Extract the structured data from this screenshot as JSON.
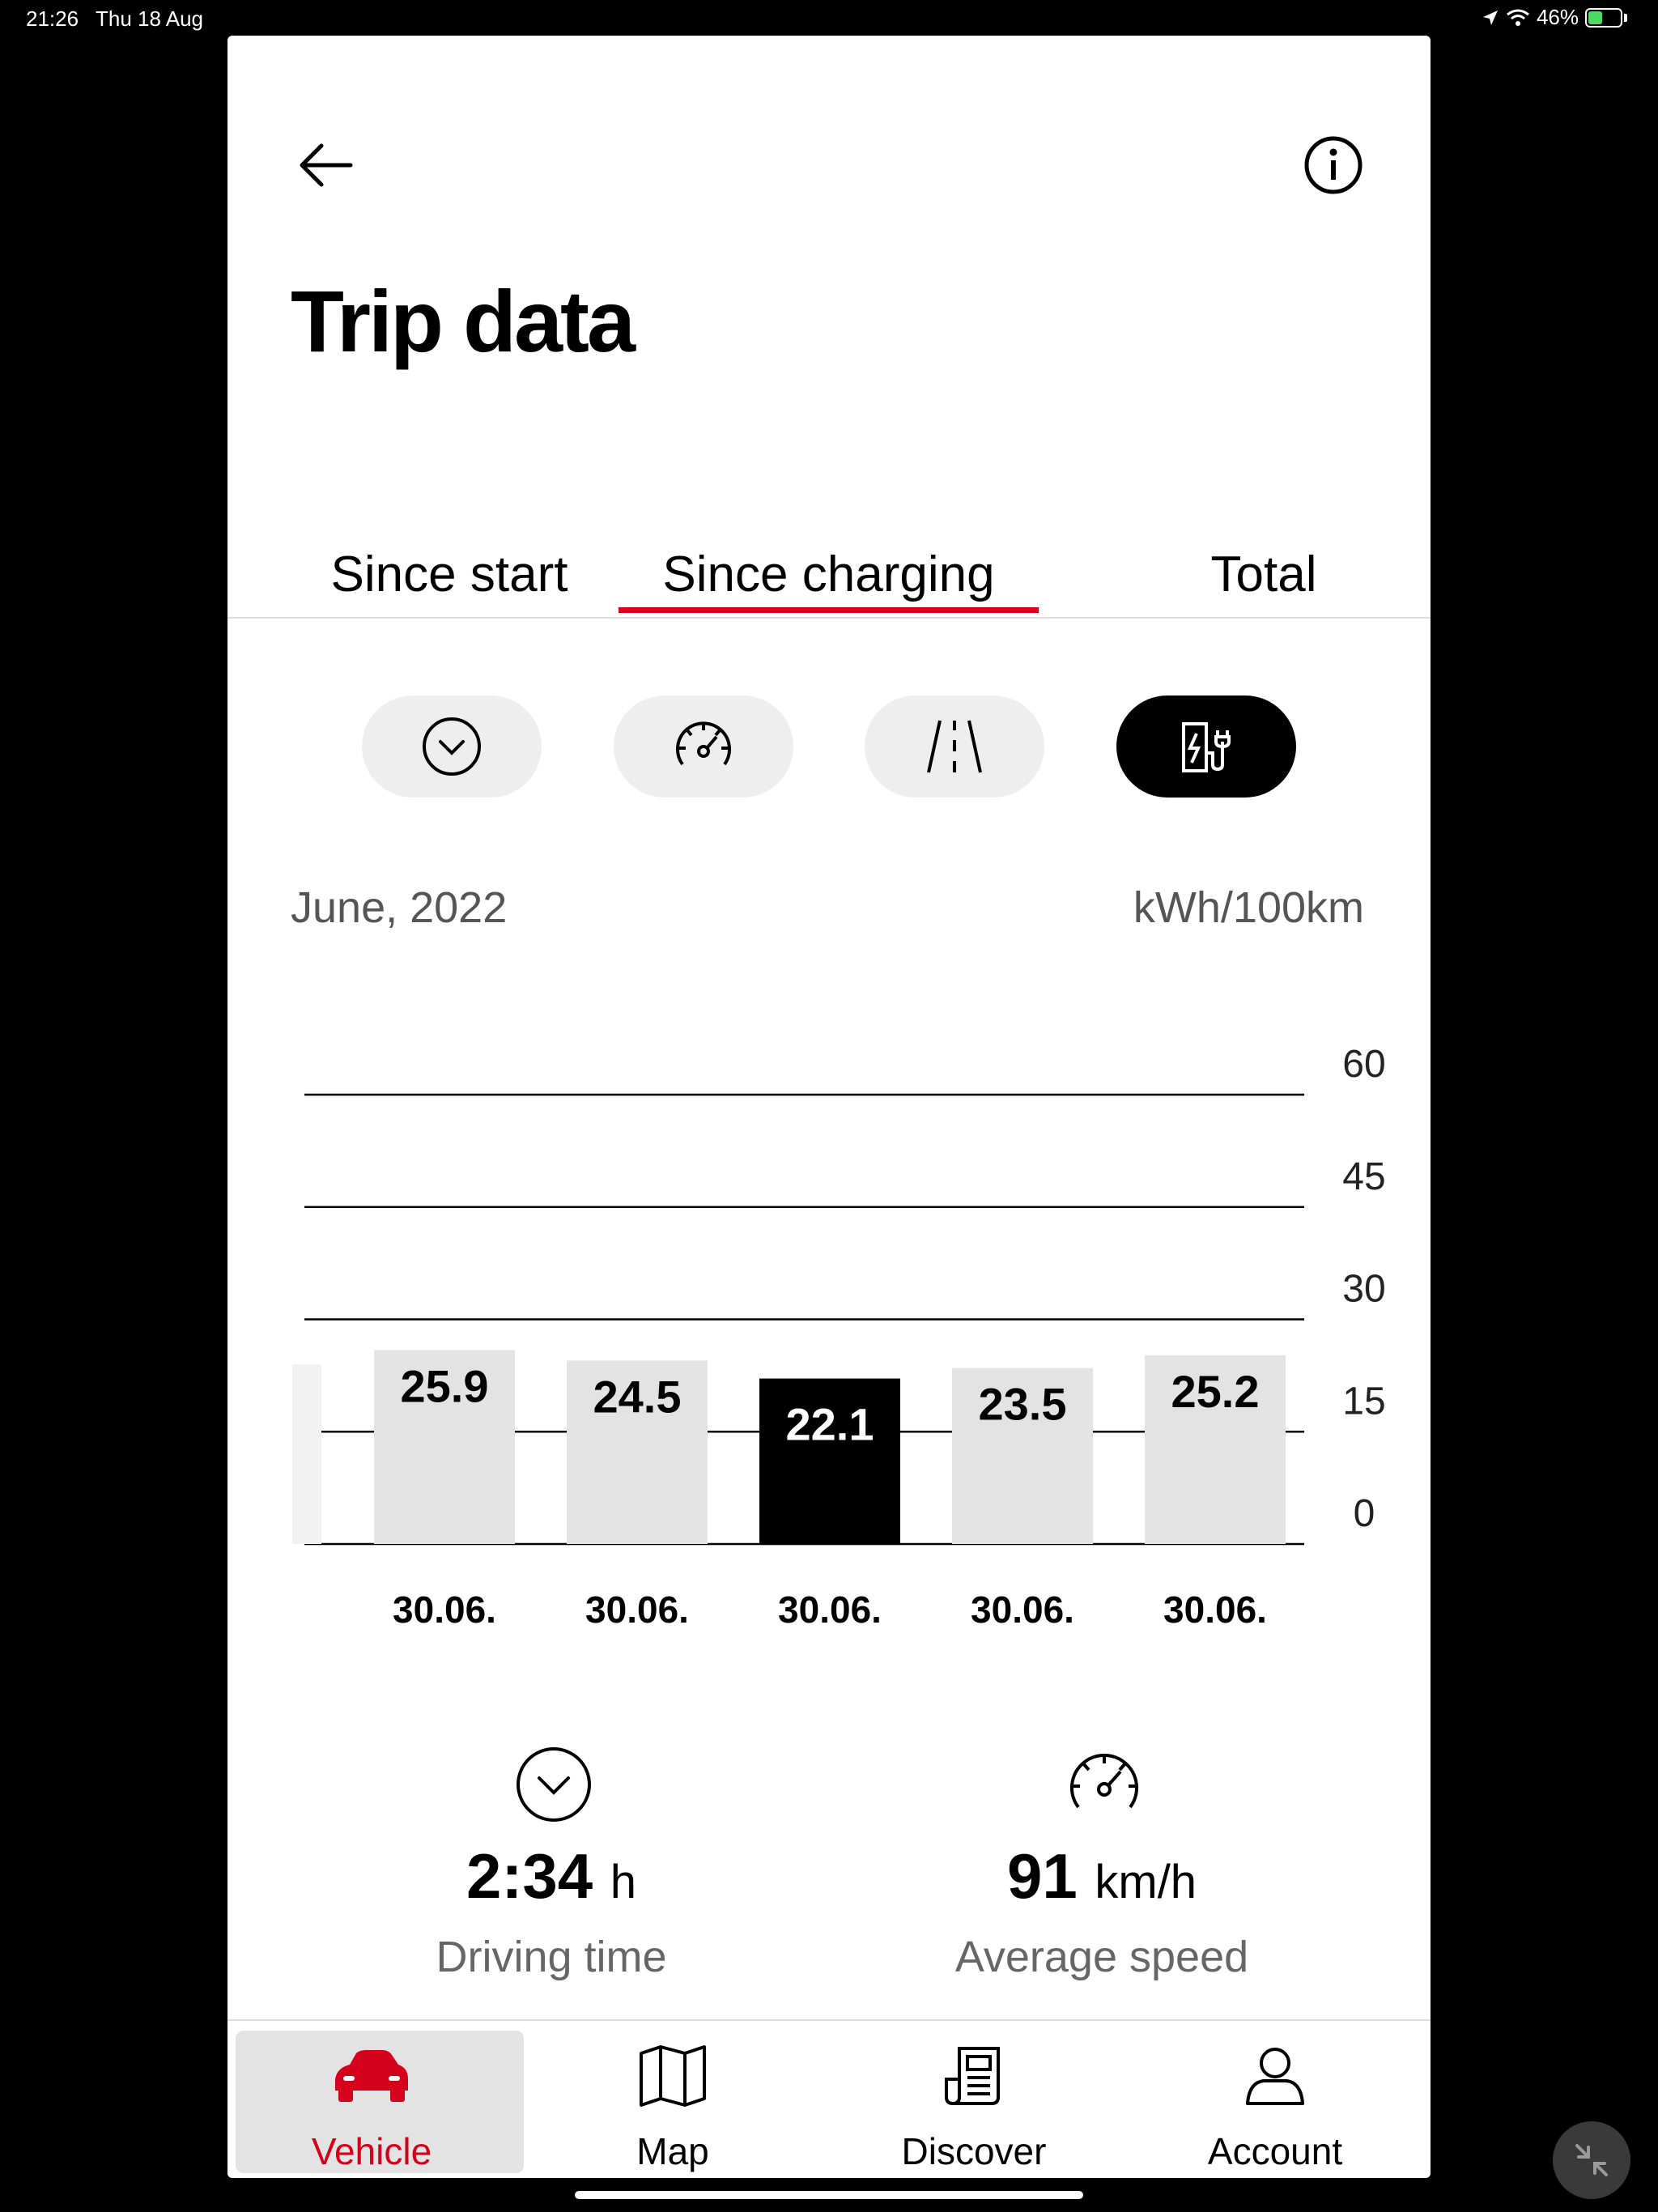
{
  "status_bar": {
    "time": "21:26",
    "date": "Thu 18 Aug",
    "battery": "46%",
    "battery_level": 0.46
  },
  "header": {
    "title": "Trip data",
    "back_icon": "arrow-left-icon",
    "info_icon": "info-icon"
  },
  "tabs": [
    {
      "label": "Since start",
      "active": false
    },
    {
      "label": "Since charging",
      "active": true
    },
    {
      "label": "Total",
      "active": false
    }
  ],
  "accent_color": "#d5001c",
  "filters": [
    {
      "icon": "clock-icon",
      "active": false
    },
    {
      "icon": "speedometer-icon",
      "active": false
    },
    {
      "icon": "road-icon",
      "active": false
    },
    {
      "icon": "charging-station-icon",
      "active": true
    }
  ],
  "chart_meta": {
    "period": "June, 2022",
    "unit": "kWh/100km"
  },
  "chart_data": {
    "type": "bar",
    "categories": [
      "30.06.",
      "30.06.",
      "30.06.",
      "30.06.",
      "30.06."
    ],
    "values": [
      25.9,
      24.5,
      22.1,
      23.5,
      25.2
    ],
    "selected_index": 2,
    "y_ticks": [
      "60",
      "45",
      "30",
      "15",
      "0"
    ],
    "ylim": [
      0,
      60
    ],
    "ylabel": "kWh/100km",
    "grid": true,
    "bar_color": "#e3e3e3",
    "selected_color": "#000000"
  },
  "stats": [
    {
      "icon": "clock-icon",
      "value": "2:34",
      "unit": "h",
      "label": "Driving time"
    },
    {
      "icon": "speedometer-icon",
      "value": "91",
      "unit": "km/h",
      "label": "Average speed"
    }
  ],
  "bottom_nav": [
    {
      "label": "Vehicle",
      "icon": "car-icon",
      "active": true
    },
    {
      "label": "Map",
      "icon": "map-icon",
      "active": false
    },
    {
      "label": "Discover",
      "icon": "newspaper-icon",
      "active": false
    },
    {
      "label": "Account",
      "icon": "user-icon",
      "active": false
    }
  ]
}
